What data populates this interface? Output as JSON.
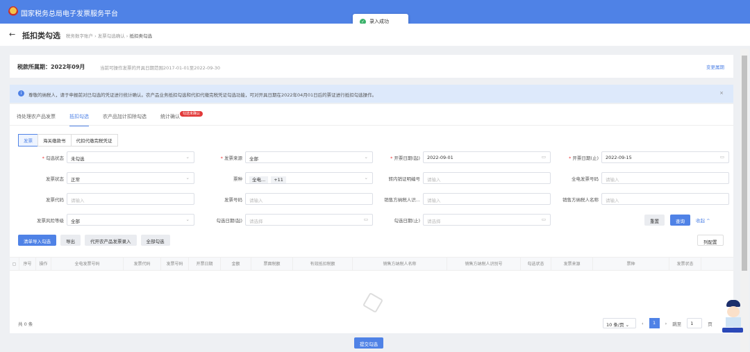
{
  "header": {
    "title": "国家税务总局电子发票服务平台"
  },
  "toast": {
    "message": "录入成功"
  },
  "page": {
    "title": "抵扣类勾选",
    "breadcrumb": [
      "税务数字账户",
      "发票勾选确认",
      "抵扣类勾选"
    ]
  },
  "period": {
    "label": "税款所属期：",
    "value": "2022年09月",
    "desc": "当前可操作发票的开具日期范围2017-01-01至2022-09-30",
    "change": "变更属期"
  },
  "alert": {
    "message": "尊敬的纳税人，请于申报前对已勾选的凭证进行统计确认。农产品业务抵扣勾选和代扣代缴完税凭证勾选功能，可对开具日期在2022年04月01日后的票证进行抵扣勾选操作。"
  },
  "tabs": [
    {
      "label": "待处理农产品发票"
    },
    {
      "label": "抵扣勾选"
    },
    {
      "label": "农产品加计扣除勾选"
    },
    {
      "label": "统计确认",
      "badge": "勾选未确认"
    }
  ],
  "subtabs": [
    "发票",
    "海关缴款书",
    "代扣代缴完税凭证"
  ],
  "form": [
    {
      "label": "勾选状态",
      "req": "*",
      "value": "未勾选",
      "type": "select"
    },
    {
      "label": "发票来源",
      "req": "*",
      "value": "全部",
      "type": "select"
    },
    {
      "label": "开票日期(起)",
      "req": "*",
      "value": "2022-09-01",
      "type": "date"
    },
    {
      "label": "开票日期(止)",
      "req": "*",
      "value": "2022-09-15",
      "type": "date"
    },
    {
      "label": "发票状态",
      "value": "正常",
      "type": "select"
    },
    {
      "label": "票种",
      "tags": [
        "全电...",
        "+11"
      ],
      "type": "select"
    },
    {
      "label": "转内销证明编号",
      "placeholder": "请输入",
      "type": "input"
    },
    {
      "label": "全电发票号码",
      "placeholder": "请输入",
      "type": "input"
    },
    {
      "label": "发票代码",
      "placeholder": "请输入",
      "type": "input"
    },
    {
      "label": "发票号码",
      "placeholder": "请输入",
      "type": "input"
    },
    {
      "label": "销售方纳税人识...",
      "placeholder": "请输入",
      "type": "input"
    },
    {
      "label": "销售方纳税人名称",
      "placeholder": "请输入",
      "type": "input"
    },
    {
      "label": "发票风险等级",
      "value": "全部",
      "type": "select"
    },
    {
      "label": "勾选日期(起)",
      "placeholder": "请选择",
      "type": "date"
    },
    {
      "label": "勾选日期(止)",
      "placeholder": "请选择",
      "type": "date"
    }
  ],
  "buttons": {
    "reset": "重置",
    "query": "查询",
    "collapse": "收起",
    "import": "清单导入勾选",
    "export": "导出",
    "agri": "代开农产品发票录入",
    "all": "全部勾选",
    "columns": "列配置",
    "submit": "提交勾选"
  },
  "table": {
    "columns": [
      "序号",
      "操作",
      "全电发票号码",
      "发票代码",
      "发票号码",
      "开票日期",
      "金额",
      "票面税额",
      "有效抵扣税额",
      "销售方纳税人名称",
      "销售方纳税人识别号",
      "勾选状态",
      "发票来源",
      "票种",
      "发票状态"
    ],
    "total": "共 0 条"
  },
  "pagination": {
    "size": "10 条/页",
    "current": "1",
    "goto": "跳至",
    "goto_value": "1",
    "page_suffix": "页"
  },
  "colors": {
    "primary": "#4f82e6"
  }
}
